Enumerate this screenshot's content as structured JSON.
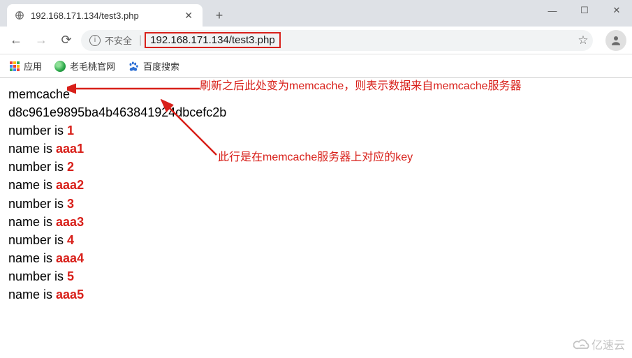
{
  "window": {
    "minimize": "—",
    "maximize": "☐",
    "close": "✕"
  },
  "tab": {
    "title": "192.168.171.134/test3.php",
    "close": "✕",
    "new": "+"
  },
  "nav": {
    "back": "←",
    "forward": "→",
    "reload": "⟳"
  },
  "address": {
    "info": "i",
    "insecure": "不安全",
    "sep": "|",
    "url": "192.168.171.134/test3.php",
    "star": "☆"
  },
  "bookmarks": {
    "apps": "应用",
    "site1": "老毛桃官网",
    "site2": "百度搜索"
  },
  "page": {
    "source": "memcache",
    "key": "d8c961e9895ba4b463841924dbcefc2b",
    "rows": [
      {
        "numlabel": "number is ",
        "num": "1",
        "namelabel": "name is ",
        "name": "aaa1"
      },
      {
        "numlabel": "number is ",
        "num": "2",
        "namelabel": "name is ",
        "name": "aaa2"
      },
      {
        "numlabel": "number is ",
        "num": "3",
        "namelabel": "name is ",
        "name": "aaa3"
      },
      {
        "numlabel": "number is ",
        "num": "4",
        "namelabel": "name is ",
        "name": "aaa4"
      },
      {
        "numlabel": "number is ",
        "num": "5",
        "namelabel": "name is ",
        "name": "aaa5"
      }
    ]
  },
  "annotations": {
    "a1": "刷新之后此处变为memcache，则表示数据来自memcache服务器",
    "a2": "此行是在memcache服务器上对应的key"
  },
  "watermark": "亿速云"
}
